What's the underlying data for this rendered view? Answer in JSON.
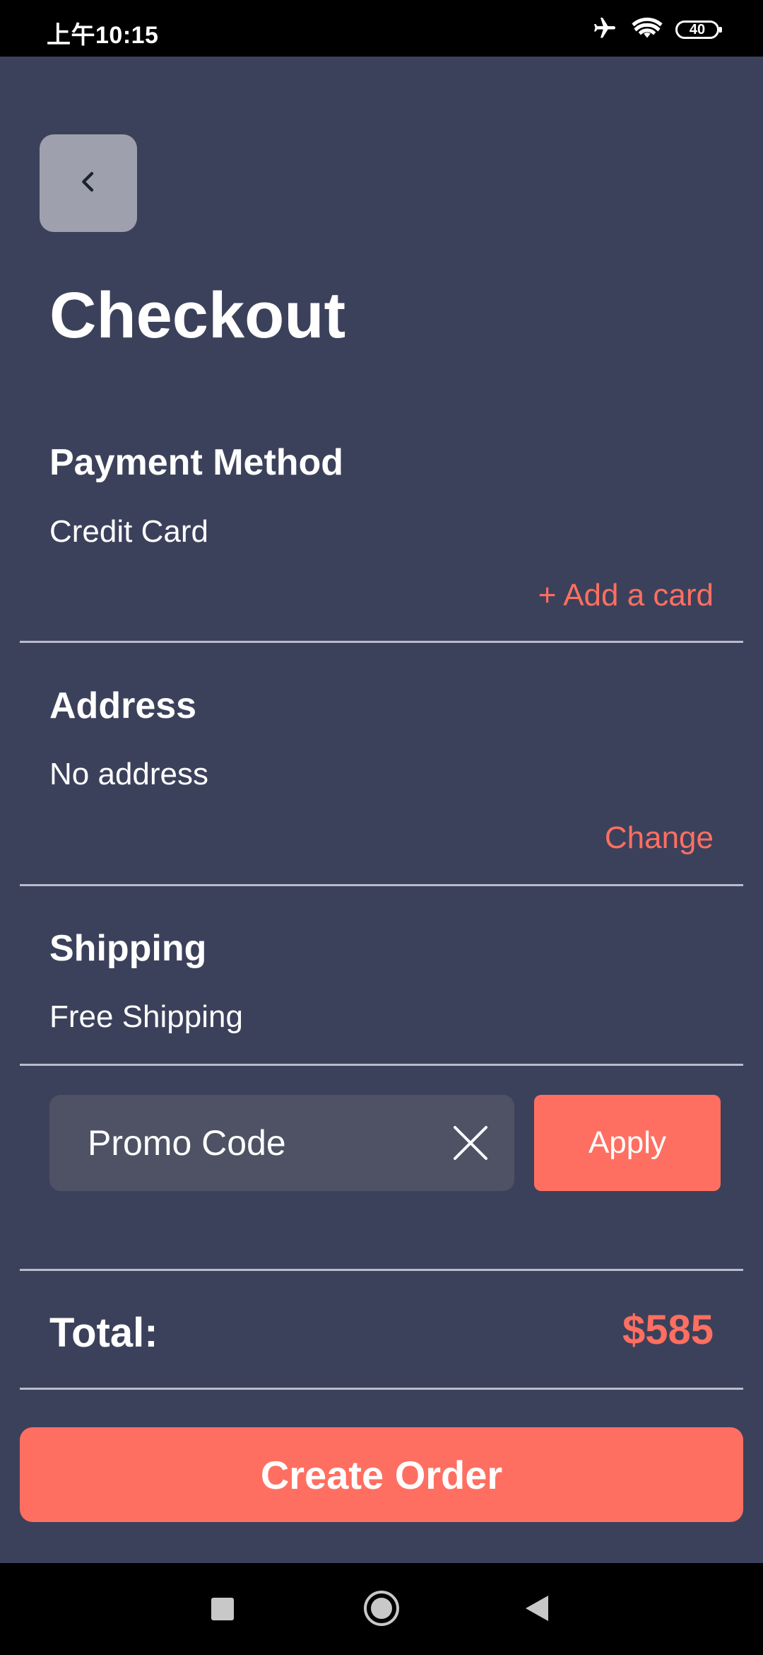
{
  "status_bar": {
    "time": "上午10:15",
    "battery": "40",
    "icons": [
      "airplane-icon",
      "wifi-icon",
      "battery-icon"
    ]
  },
  "header": {
    "back_icon": "chevron-left-icon",
    "title": "Checkout"
  },
  "payment": {
    "title": "Payment Method",
    "value": "Credit Card",
    "action": "+ Add a card"
  },
  "address": {
    "title": "Address",
    "value": "No address",
    "action": "Change"
  },
  "shipping": {
    "title": "Shipping",
    "value": "Free Shipping"
  },
  "promo": {
    "placeholder": "Promo Code",
    "value": "",
    "clear_icon": "close-icon",
    "apply_label": "Apply"
  },
  "total": {
    "label": "Total:",
    "value": "$585"
  },
  "create_order_label": "Create Order",
  "nav_bar": {
    "icons": [
      "recents-square-icon",
      "home-circle-icon",
      "back-triangle-icon"
    ]
  },
  "colors": {
    "background": "#3c415b",
    "accent": "#ff6f61",
    "input_background": "#4e5264",
    "back_button": "#9ea1ad",
    "divider": "#b9bccb"
  }
}
